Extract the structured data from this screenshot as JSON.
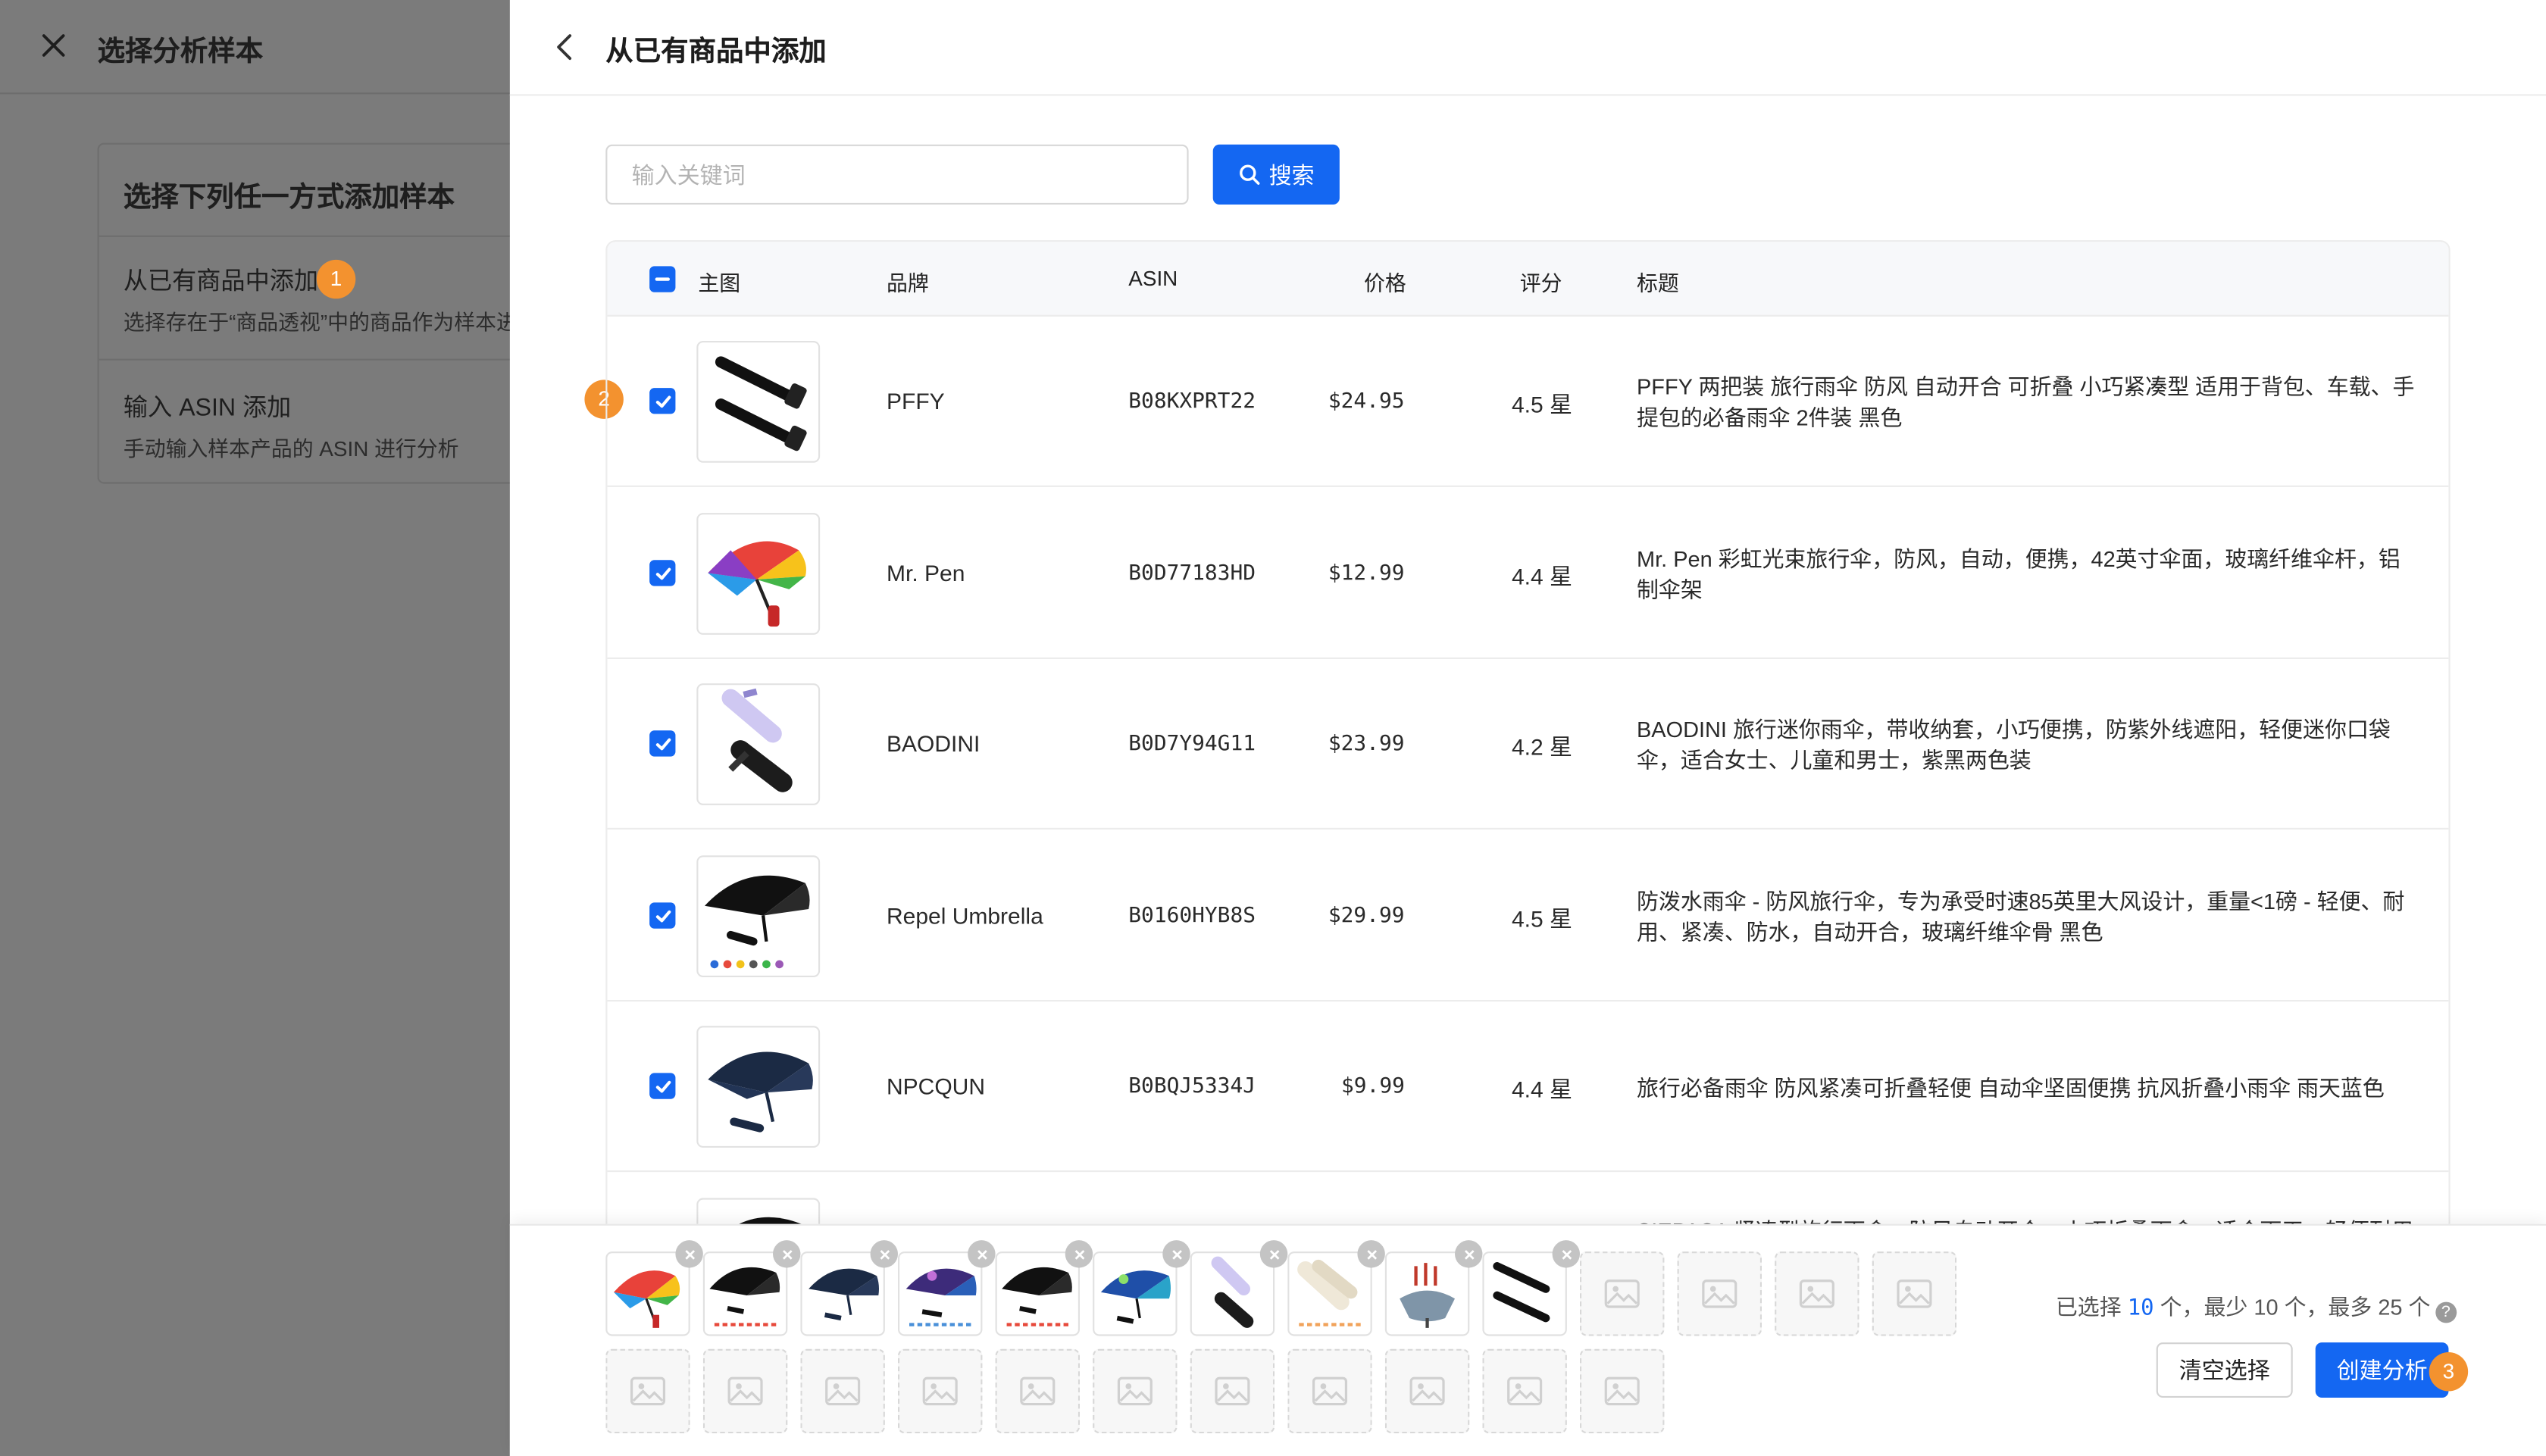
{
  "left_panel": {
    "title": "选择分析样本",
    "card_title": "选择下列任一方式添加样本",
    "options": [
      {
        "title": "从已有商品中添加",
        "desc": "选择存在于“商品透视”中的商品作为样本进行分析",
        "badge": "1"
      },
      {
        "title": "输入 ASIN 添加",
        "desc": "手动输入样本产品的 ASIN 进行分析"
      }
    ]
  },
  "drawer": {
    "title": "从已有商品中添加",
    "search": {
      "placeholder": "输入关键词",
      "value": "",
      "button_label": "搜索"
    },
    "columns": [
      "主图",
      "品牌",
      "ASIN",
      "价格",
      "评分",
      "标题"
    ],
    "rows": [
      {
        "checked": true,
        "image": "two-black-umbrellas",
        "brand": "PFFY",
        "asin": "B08KXPRT22",
        "price": "$24.95",
        "rating": "4.5 星",
        "title": "PFFY 两把装 旅行雨伞 防风 自动开合 可折叠 小巧紧凑型 适用于背包、车载、手提包的必备雨伞 2件装 黑色"
      },
      {
        "checked": true,
        "image": "rainbow-umbrella",
        "brand": "Mr. Pen",
        "asin": "B0D77183HD",
        "price": "$12.99",
        "rating": "4.4 星",
        "title": "Mr. Pen 彩虹光束旅行伞，防风，自动，便携，42英寸伞面，玻璃纤维伞杆，铝制伞架"
      },
      {
        "checked": true,
        "image": "mini-umbrellas-purple-black",
        "brand": "BAODINI",
        "asin": "B0D7Y94G11",
        "price": "$23.99",
        "rating": "4.2 星",
        "title": "BAODINI 旅行迷你雨伞，带收纳套，小巧便携，防紫外线遮阳，轻便迷你口袋伞，适合女士、儿童和男士，紫黑两色装"
      },
      {
        "checked": true,
        "image": "black-umbrella-colors",
        "brand": "Repel Umbrella",
        "asin": "B0160HYB8S",
        "price": "$29.99",
        "rating": "4.5 星",
        "title": "防泼水雨伞 - 防风旅行伞，专为承受时速85英里大风设计，重量<1磅 - 轻便、耐用、紧凑、防水，自动开合，玻璃纤维伞骨 黑色"
      },
      {
        "checked": true,
        "image": "navy-umbrella",
        "brand": "NPCQUN",
        "asin": "B0BQJ5334J",
        "price": "$9.99",
        "rating": "4.4 星",
        "title": "旅行必备雨伞 防风紧凑可折叠轻便 自动伞坚固便携 抗风折叠小雨伞 雨天蓝色"
      },
      {
        "checked": true,
        "image": "black-umbrella-partial",
        "brand": "",
        "asin": "",
        "price": "",
        "rating": "",
        "title": "SIEPASA 紧凑型旅行雨伞，防风自动开合，小巧折叠雨伞，适合雨天，轻便耐用"
      }
    ],
    "step_badge_2": "2",
    "selection": {
      "selected_items": [
        "rainbow-umbrella",
        "black-umbrella-colors",
        "navy-umbrella",
        "galaxy-umbrella",
        "black-umbrella-colors-2",
        "blue-galaxy-umbrella",
        "mini-umbrellas-purple-black",
        "white-umbrella-set",
        "inverted-umbrella-set",
        "two-black-umbrellas"
      ],
      "summary_prefix": "已选择 ",
      "count": "10",
      "summary_mid": " 个，最少 10 个，最多 25 个",
      "clear_label": "清空选择",
      "create_label": "创建分析",
      "step_badge_3": "3"
    }
  },
  "colors": {
    "accent": "#1467f2",
    "badge": "#f3922f",
    "overlay": "#7b7b7b"
  }
}
